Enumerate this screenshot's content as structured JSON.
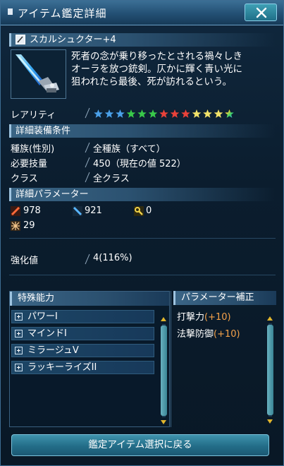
{
  "window": {
    "title": "アイテム鑑定詳細",
    "close_icon": "close-x-icon"
  },
  "weapon": {
    "name": "スカルシュクター+4",
    "type_icon": "sword-icon",
    "description_lines": [
      "死者の念が乗り移ったとされる禍々しき",
      "オーラを放つ銃剣。仄かに輝く青い光に",
      "狙われたら最後、死が訪れるという。"
    ]
  },
  "rarity": {
    "label": "レアリティ",
    "stars": 13,
    "star_colors": [
      "#4aa0e8",
      "#4aa0e8",
      "#4aa0e8",
      "#39c94a",
      "#39c94a",
      "#39c94a",
      "#e8423a",
      "#e8423a",
      "#e8423a",
      "#f2e36a",
      "#f2e36a",
      "#f2e36a",
      "rainbow"
    ]
  },
  "requirements": {
    "header": "詳細装備条件",
    "rows": [
      {
        "label": "種族(性別)",
        "value": "全種族（すべて）"
      },
      {
        "label": "必要技量",
        "value": "450（現在の値 522）"
      },
      {
        "label": "クラス",
        "value": "全クラス"
      }
    ]
  },
  "parameters": {
    "header": "詳細パラメーター",
    "stats": [
      {
        "icon": "striking-attack-icon",
        "value": "978"
      },
      {
        "icon": "ranged-attack-icon",
        "value": "921"
      },
      {
        "icon": "technique-attack-icon",
        "value": "0"
      },
      {
        "icon": "element-icon",
        "value": "29"
      }
    ]
  },
  "enhancement": {
    "label": "強化値",
    "value": "4(116%)"
  },
  "abilities": {
    "header": "特殊能力",
    "items": [
      "パワーI",
      "マインドI",
      "ミラージュV",
      "ラッキーライズII"
    ]
  },
  "param_bonus": {
    "header": "パラメーター補正",
    "rows": [
      {
        "label": "打撃力",
        "value": "(+10)"
      },
      {
        "label": "法撃防御",
        "value": "(+10)"
      }
    ]
  },
  "footer": {
    "back_label": "鑑定アイテム選択に戻る"
  }
}
